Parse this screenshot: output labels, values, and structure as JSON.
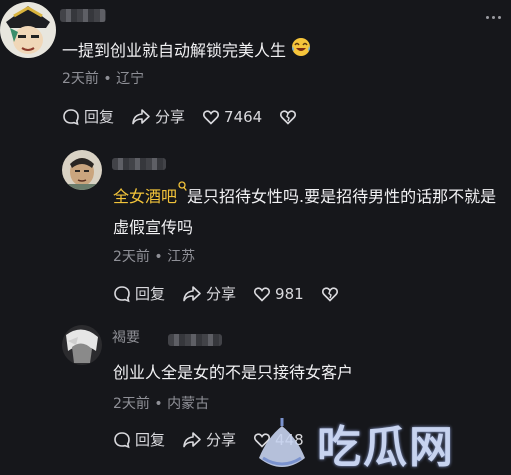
{
  "comments": [
    {
      "text": "一提到创业就自动解锁完美人生",
      "emoji_icon": "laughing-crying-emoji",
      "time": "2天前",
      "location": "辽宁",
      "reply_label": "回复",
      "share_label": "分享",
      "likes": "7464"
    },
    {
      "tag": "全女酒吧",
      "tag_icon": "search-icon",
      "text": "是只招待女性吗.要是招待男性的话那不就是虚假宣传吗",
      "time": "2天前",
      "location": "江苏",
      "reply_label": "回复",
      "share_label": "分享",
      "likes": "981"
    },
    {
      "name_partial": "褐要",
      "text": "创业人全是女的不是只接待女客户",
      "time": "2天前",
      "location": "内蒙古",
      "reply_label": "回复",
      "share_label": "分享",
      "likes": "448"
    }
  ],
  "separator": "•",
  "watermark": {
    "text": "吃瓜网"
  },
  "colors": {
    "background": "#16171b",
    "tag": "#f2c33a",
    "meta": "#8f9097"
  }
}
